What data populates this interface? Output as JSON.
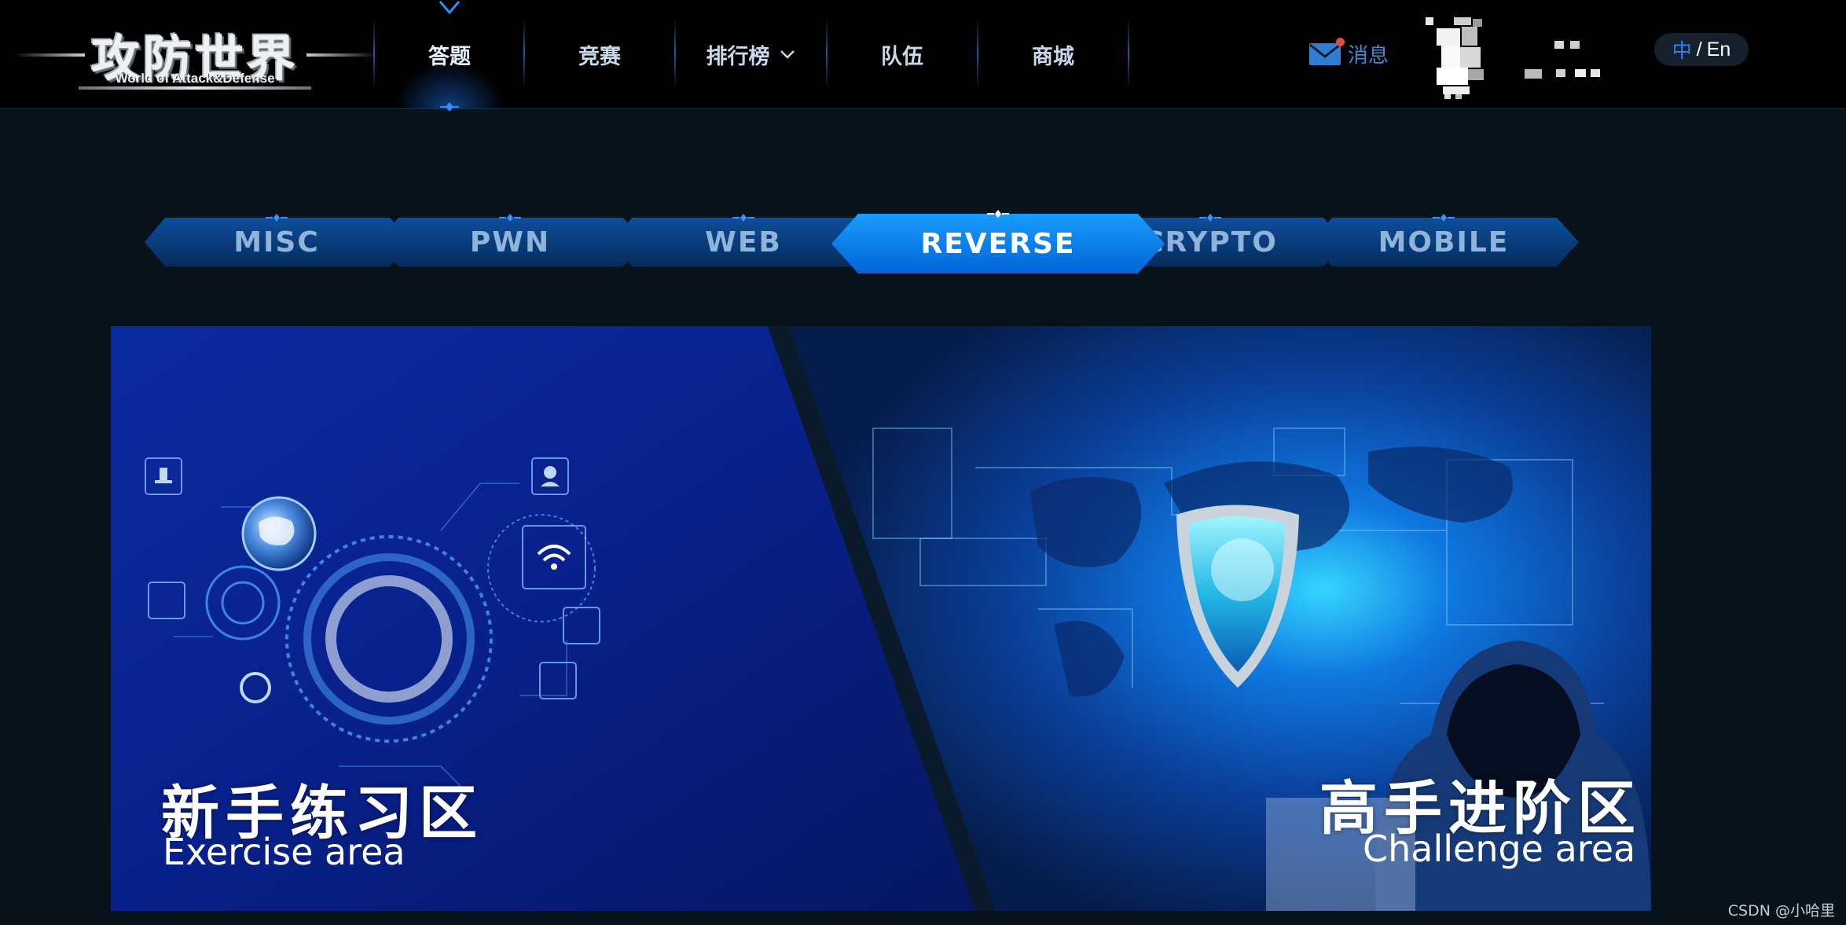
{
  "header": {
    "logo_title": "攻防世界",
    "logo_subtitle": "World of Attack&Defense",
    "nav": [
      {
        "label": "答题",
        "active": true
      },
      {
        "label": "竞赛",
        "active": false
      },
      {
        "label": "排行榜",
        "active": false,
        "has_dropdown": true
      },
      {
        "label": "队伍",
        "active": false
      },
      {
        "label": "商城",
        "active": false
      }
    ],
    "messages_label": "消息",
    "messages_icon": "mail-icon",
    "lang": {
      "zh": "中",
      "separator": "/",
      "en": "En"
    }
  },
  "tabs": [
    {
      "label": "MISC",
      "active": false
    },
    {
      "label": "PWN",
      "active": false
    },
    {
      "label": "WEB",
      "active": false
    },
    {
      "label": "REVERSE",
      "active": true
    },
    {
      "label": "CRYPTO",
      "active": false
    },
    {
      "label": "MOBILE",
      "active": false
    }
  ],
  "areas": {
    "exercise": {
      "title": "新手练习区",
      "subtitle": "Exercise area"
    },
    "challenge": {
      "title": "高手进阶区",
      "subtitle": "Challenge area"
    }
  },
  "watermark": "CSDN @小哈里",
  "colors": {
    "accent": "#0a7be6",
    "nav_bg": "#000000",
    "page_bg": "#07121b",
    "lang_zh": "#2b86ff",
    "message_text": "#3f8bd8"
  }
}
